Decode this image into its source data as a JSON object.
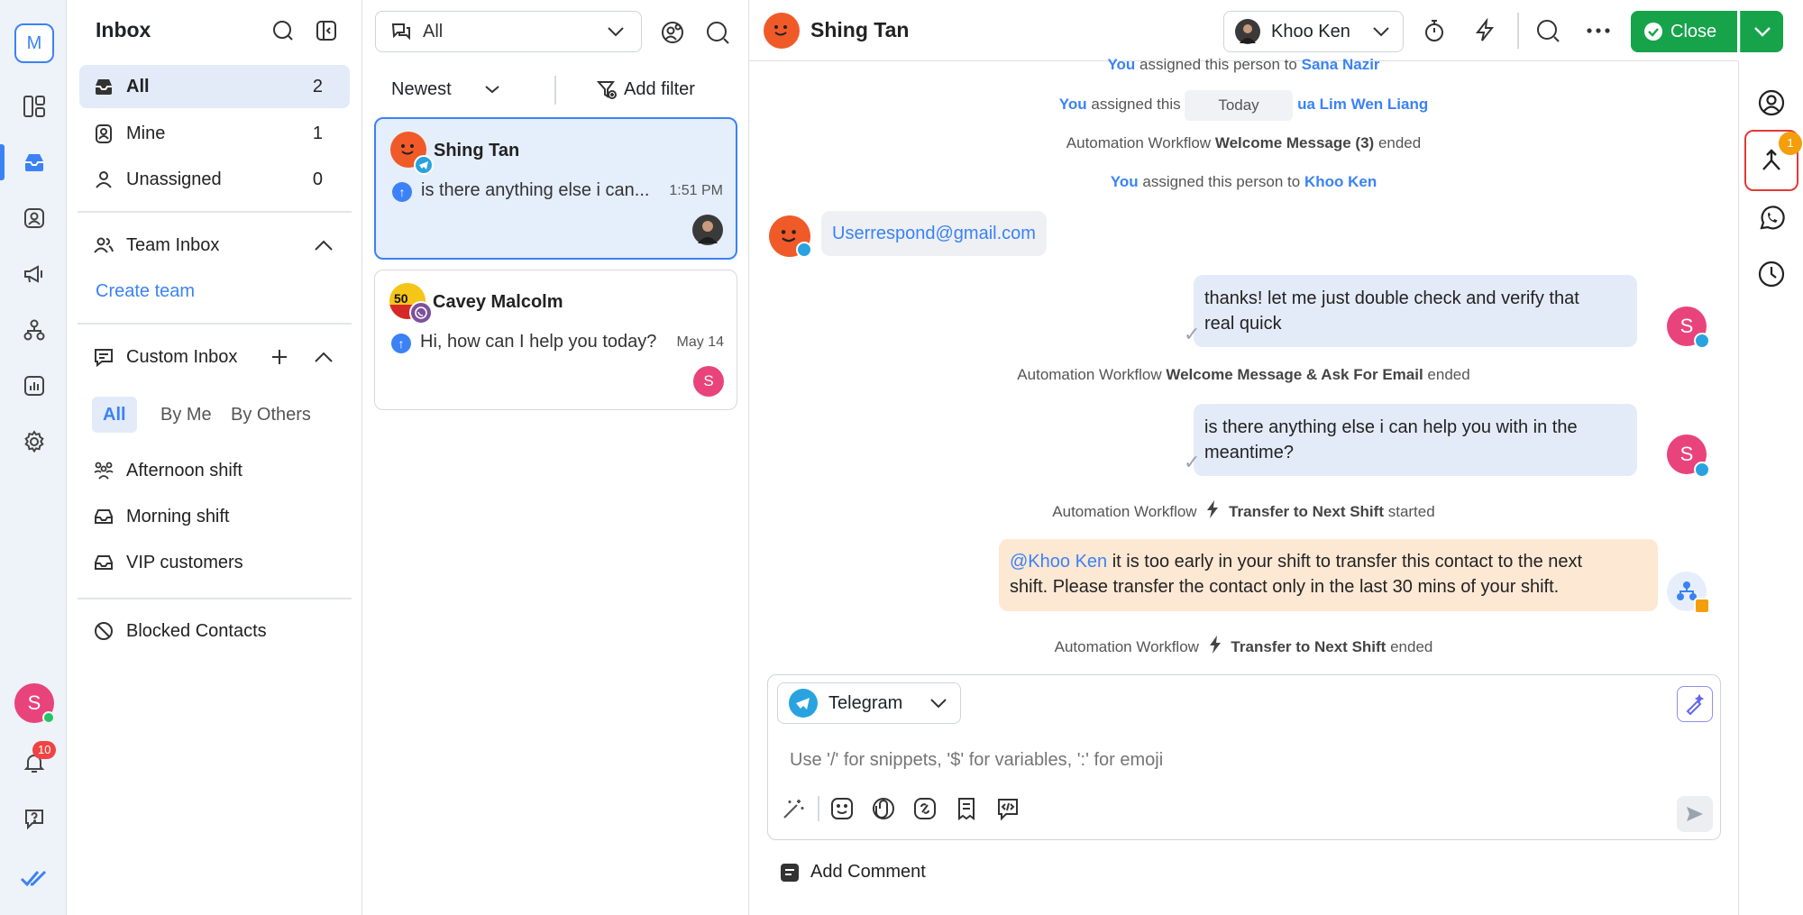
{
  "rail": {
    "logo_letter": "M",
    "avatar_letter": "S",
    "notifications_count": "10"
  },
  "inbox": {
    "title": "Inbox",
    "items": [
      {
        "label": "All",
        "count": "2"
      },
      {
        "label": "Mine",
        "count": "1"
      },
      {
        "label": "Unassigned",
        "count": "0"
      }
    ],
    "team_inbox": "Team Inbox",
    "create_team": "Create team",
    "custom_inbox": "Custom Inbox",
    "tabs": [
      "All",
      "By Me",
      "By Others"
    ],
    "custom_items": [
      "Afternoon shift",
      "Morning shift",
      "VIP customers"
    ],
    "blocked": "Blocked Contacts"
  },
  "list": {
    "filter": "All",
    "sort": "Newest",
    "add_filter": "Add filter",
    "conversations": [
      {
        "name": "Shing Tan",
        "message": "is there anything else i can...",
        "time": "1:51 PM"
      },
      {
        "name": "Cavey Malcolm",
        "message": "Hi, how can I help you today?",
        "time": "May 14",
        "assignee_letter": "S"
      }
    ]
  },
  "chat": {
    "contact_name": "Shing Tan",
    "assignee": "Khoo Ken",
    "close_label": "Close",
    "date_divider": "Today",
    "events": [
      {
        "you": "You",
        "text": "assigned this person to",
        "target": "Sana Nazir"
      },
      {
        "you": "You",
        "text": "assigned this",
        "target": "ua Lim Wen Liang"
      },
      {
        "prefix": "Automation Workflow",
        "bold": "Welcome Message (3)",
        "suffix": "ended"
      },
      {
        "you": "You",
        "text": "assigned this person to",
        "target": "Khoo Ken"
      },
      {
        "prefix": "Automation Workflow",
        "bold": "Welcome Message & Ask For Email",
        "suffix": "ended"
      },
      {
        "prefix": "Automation Workflow",
        "bold": "Transfer to Next Shift",
        "suffix": "started"
      },
      {
        "prefix": "Automation Workflow",
        "bold": "Transfer to Next Shift",
        "suffix": "ended"
      }
    ],
    "incoming_email": "Userrespond@gmail.com",
    "outgoing": [
      {
        "line1": "thanks! let me just double check and verify that",
        "line2": "real quick"
      },
      {
        "line1": "is there anything else i can help you with in the",
        "line2": "meantime?"
      }
    ],
    "note_mention": "@Khoo Ken",
    "note_line1": " it is too early in your shift to transfer this contact to the next",
    "note_line2": "shift. Please transfer the contact only in the last 30 mins of your shift.",
    "avatar_letter": "S",
    "channel": "Telegram",
    "placeholder": "Use '/' for snippets, '$' for variables, ':' for emoji",
    "add_comment": "Add Comment"
  },
  "right_rail": {
    "merge_badge": "1"
  },
  "colors": {
    "accent": "#3b82f6",
    "close_green": "#16a34a",
    "note_bg": "#fde8d4",
    "bubble_bg": "#e4ebf8"
  }
}
